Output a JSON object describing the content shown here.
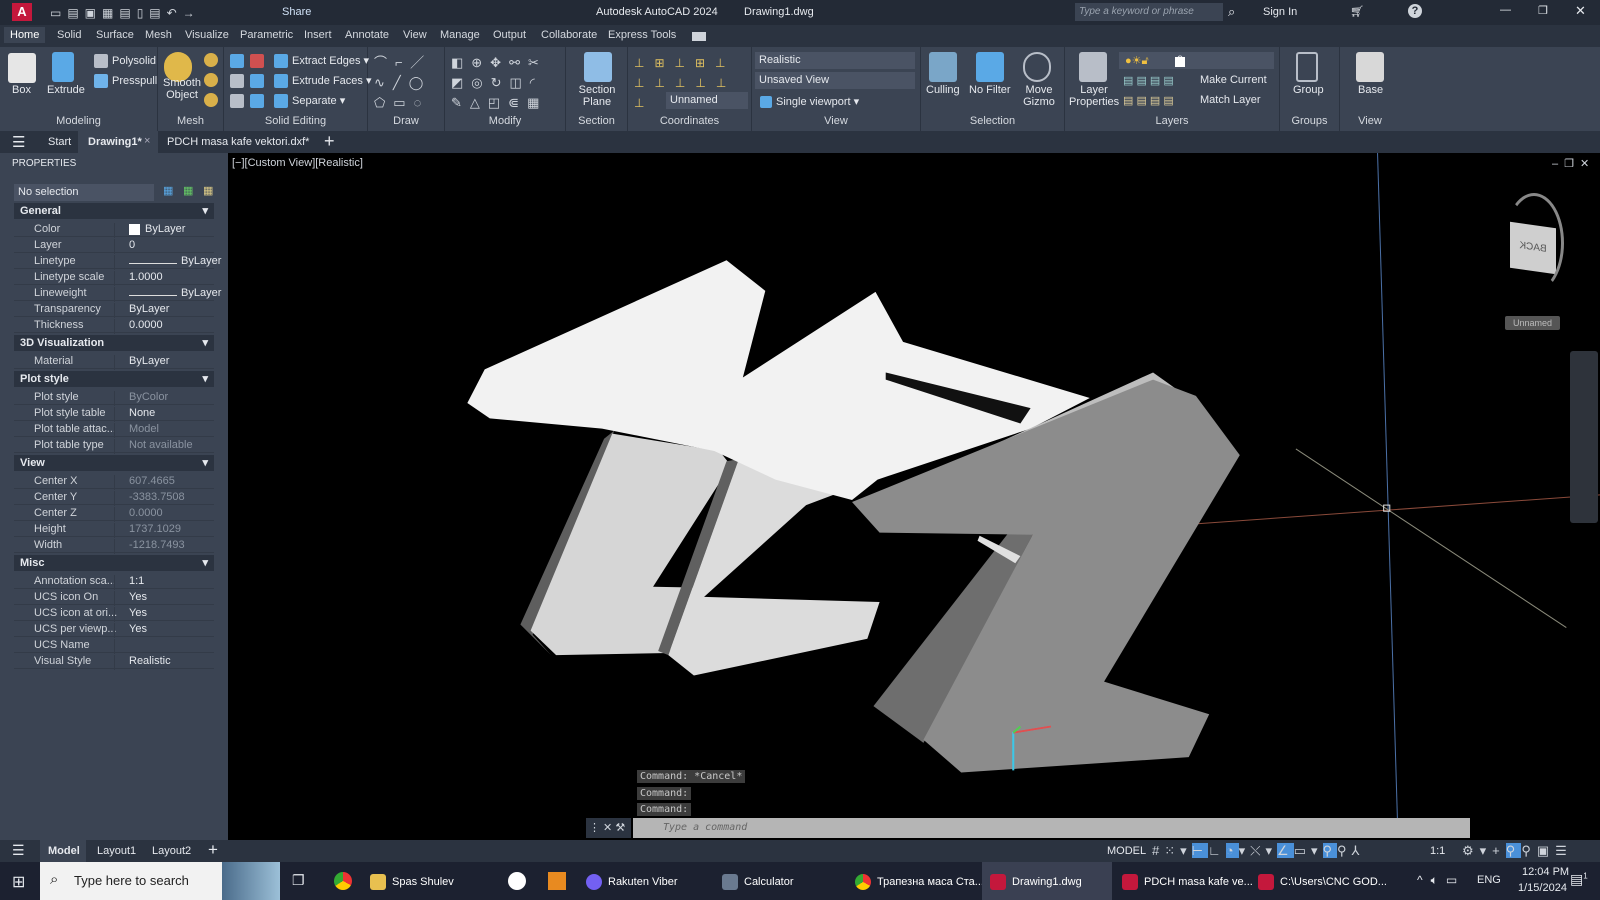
{
  "app": {
    "title": "Autodesk AutoCAD 2024",
    "file": "Drawing1.dwg",
    "share": "Share",
    "search_placeholder": "Type a keyword or phrase",
    "sign_in": "Sign In"
  },
  "ribbon_tabs": [
    "Home",
    "Solid",
    "Surface",
    "Mesh",
    "Visualize",
    "Parametric",
    "Insert",
    "Annotate",
    "View",
    "Manage",
    "Output",
    "Collaborate",
    "Express Tools"
  ],
  "panels": {
    "modeling": {
      "label": "Modeling",
      "box": "Box",
      "extrude": "Extrude",
      "polysolid": "Polysolid",
      "presspull": "Presspull"
    },
    "mesh": {
      "label": "Mesh",
      "smooth": "Smooth Object"
    },
    "solid_editing": {
      "label": "Solid Editing",
      "extract_edges": "Extract Edges",
      "extrude_faces": "Extrude Faces",
      "separate": "Separate"
    },
    "draw": {
      "label": "Draw"
    },
    "modify": {
      "label": "Modify"
    },
    "section": {
      "label": "Section",
      "section_plane": "Section Plane"
    },
    "coordinates": {
      "label": "Coordinates",
      "ucs": "Unnamed"
    },
    "view": {
      "label": "View",
      "visual_style": "Realistic",
      "named_view": "Unsaved View",
      "viewport": "Single viewport"
    },
    "selection": {
      "label": "Selection",
      "culling": "Culling",
      "no_filter": "No Filter",
      "move_gizmo": "Move Gizmo"
    },
    "layers": {
      "label": "Layers",
      "layer_properties": "Layer Properties",
      "current_layer": "0",
      "make_current": "Make Current",
      "match_layer": "Match Layer"
    },
    "groups": {
      "label": "Groups",
      "group": "Group"
    },
    "view2": {
      "label": "View",
      "base": "Base"
    }
  },
  "file_tabs": {
    "start": "Start",
    "items": [
      "Drawing1*",
      "PDCH masa kafe vektori.dxf*"
    ]
  },
  "properties": {
    "title": "PROPERTIES",
    "selection": "No selection",
    "sections": [
      {
        "name": "General",
        "rows": [
          [
            "Color",
            "ByLayer"
          ],
          [
            "Layer",
            "0"
          ],
          [
            "Linetype",
            "ByLayer"
          ],
          [
            "Linetype scale",
            "1.0000"
          ],
          [
            "Lineweight",
            "ByLayer"
          ],
          [
            "Transparency",
            "ByLayer"
          ],
          [
            "Thickness",
            "0.0000"
          ]
        ]
      },
      {
        "name": "3D Visualization",
        "rows": [
          [
            "Material",
            "ByLayer"
          ]
        ]
      },
      {
        "name": "Plot style",
        "rows": [
          [
            "Plot style",
            "ByColor"
          ],
          [
            "Plot style table",
            "None"
          ],
          [
            "Plot table attac...",
            "Model"
          ],
          [
            "Plot table type",
            "Not available"
          ]
        ]
      },
      {
        "name": "View",
        "rows": [
          [
            "Center X",
            "607.4665"
          ],
          [
            "Center Y",
            "-3383.7508"
          ],
          [
            "Center Z",
            "0.0000"
          ],
          [
            "Height",
            "1737.1029"
          ],
          [
            "Width",
            "-1218.7493"
          ]
        ]
      },
      {
        "name": "Misc",
        "rows": [
          [
            "Annotation sca...",
            "1:1"
          ],
          [
            "UCS icon On",
            "Yes"
          ],
          [
            "UCS icon at ori...",
            "Yes"
          ],
          [
            "UCS per viewp...",
            "Yes"
          ],
          [
            "UCS Name",
            ""
          ],
          [
            "Visual Style",
            "Realistic"
          ]
        ]
      }
    ]
  },
  "viewport": {
    "label": "[−][Custom View][Realistic]",
    "viewcube_face": "BACK",
    "viewcube_ucs": "Unnamed"
  },
  "command": {
    "history": [
      "Command: *Cancel*",
      "Command:",
      "Command:"
    ],
    "placeholder": "Type a command"
  },
  "layout_tabs": [
    "Model",
    "Layout1",
    "Layout2"
  ],
  "status": {
    "mode": "MODEL",
    "scale": "1:1"
  },
  "taskbar": {
    "search": "Type here to search",
    "items": [
      "Spas Shulev",
      "Rakuten Viber",
      "Calculator",
      "Трапезна маса Ста...",
      "Drawing1.dwg",
      "PDCH masa kafe ve...",
      "C:\\Users\\CNC GOD..."
    ],
    "active": "Drawing1.dwg",
    "lang": "ENG",
    "time": "12:04 PM",
    "date": "1/15/2024",
    "notifications": "1"
  },
  "colors": {
    "accent": "#c4183c",
    "ribbon": "#3b4453",
    "dark": "#2b3340",
    "highlight": "#4a90d9"
  }
}
